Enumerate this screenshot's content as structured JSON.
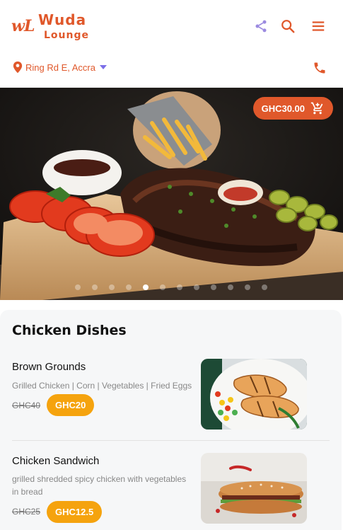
{
  "brand": {
    "logo_mark": "wL",
    "name_line1": "Wuda",
    "name_line2": "Lounge"
  },
  "header_icons": [
    "share-icon",
    "search-icon",
    "menu-icon"
  ],
  "location": {
    "label": "Ring Rd E, Accra"
  },
  "cart": {
    "price": "GHC30.00"
  },
  "carousel": {
    "slide_count": 12,
    "active_index": 4
  },
  "section": {
    "title": "Chicken Dishes"
  },
  "dishes": [
    {
      "name": "Brown Grounds",
      "description": "Grilled Chicken | Corn | Vegetables | Fried Eggs",
      "old_price": "GHC40",
      "price": "GHC20"
    },
    {
      "name": "Chicken Sandwich",
      "description": "grilled shredded spicy chicken with vegetables in bread",
      "old_price": "GHC25",
      "price": "GHC12.5"
    }
  ],
  "colors": {
    "accent": "#e0582b",
    "price_badge": "#f5a30e",
    "share_icon": "#9b8ae0",
    "dropdown_caret": "#7b6ee8"
  }
}
